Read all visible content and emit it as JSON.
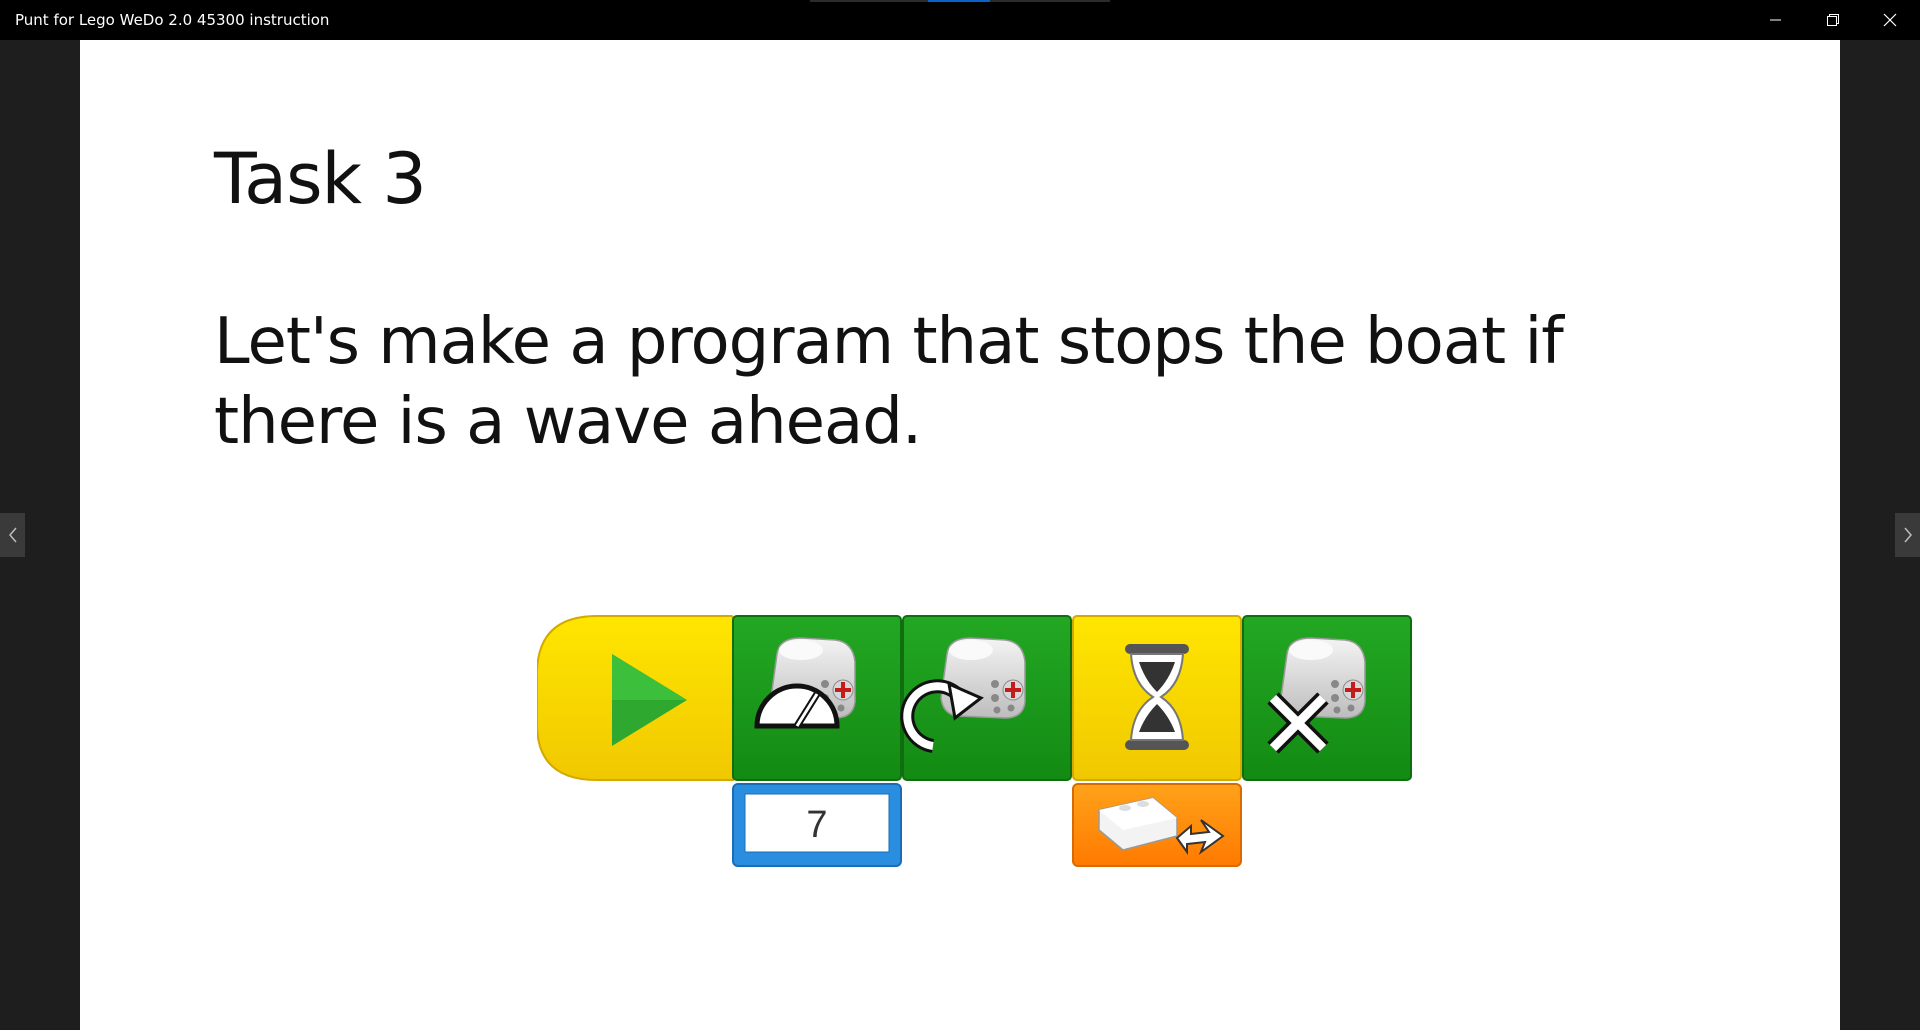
{
  "window": {
    "title": "Punt for Lego WeDo 2.0 45300 instruction",
    "controls": {
      "minimize_icon": "minimize-icon",
      "restore_icon": "restore-icon",
      "close_icon": "close-icon"
    }
  },
  "slide": {
    "title": "Task 3",
    "body": "Let's make a program that stops the boat if there is a wave ahead."
  },
  "navigation": {
    "prev_icon": "chevron-left-icon",
    "next_icon": "chevron-right-icon"
  },
  "program_blocks": [
    {
      "name": "start-block",
      "icon": "play-icon",
      "color": "#f5d800"
    },
    {
      "name": "motor-power-block",
      "icon": "motor-speed-icon",
      "color": "#1e9a1e",
      "input": "7"
    },
    {
      "name": "motor-direction-block",
      "icon": "motor-turn-icon",
      "color": "#1e9a1e"
    },
    {
      "name": "wait-block",
      "icon": "hourglass-icon",
      "color": "#f5d800",
      "input_icon": "tilt-sensor-icon"
    },
    {
      "name": "motor-stop-block",
      "icon": "motor-stop-icon",
      "color": "#1e9a1e"
    }
  ],
  "colors": {
    "titlebar": "#000000",
    "background": "#1e1e1e",
    "slide": "#ffffff",
    "yellow_block": "#f5d800",
    "green_block": "#1e9a1e",
    "blue_input": "#2a8ee0",
    "orange_input": "#ff8a00"
  }
}
